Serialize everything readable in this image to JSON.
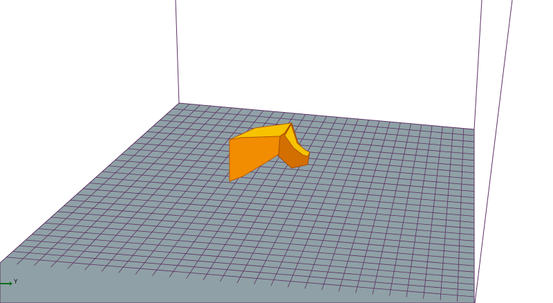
{
  "viewport": {
    "axis_label": "Y",
    "colors": {
      "background": "#ffffff",
      "bed_fill": "#8fa1a6",
      "grid_line": "#5b2f63",
      "volume_edge": "#5b2f63",
      "model_top": "#f7c300",
      "model_side_light": "#f28c00",
      "model_side_dark": "#d36e00",
      "axis_y": "#0b6b1f"
    },
    "icons": {
      "axis_indicator": "axis-y-arrow-icon"
    }
  }
}
